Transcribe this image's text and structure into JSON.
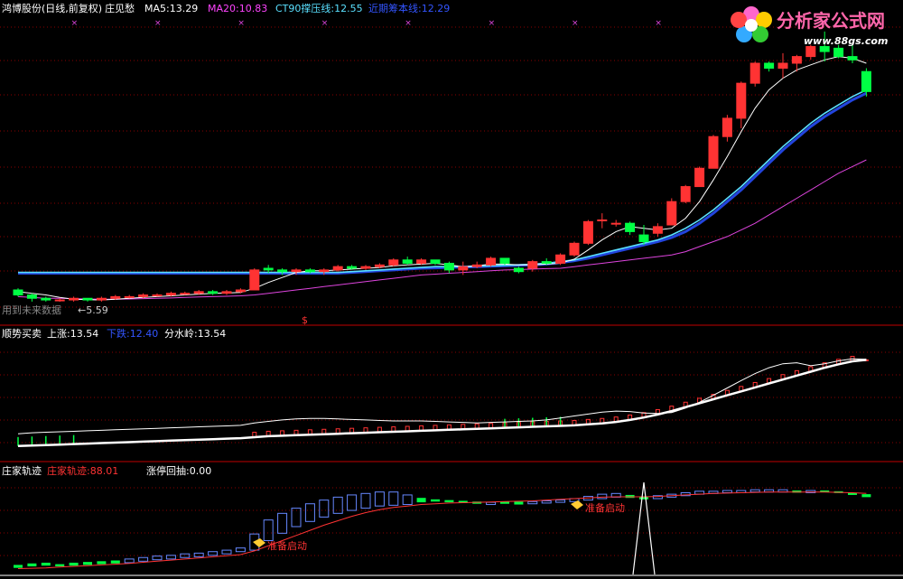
{
  "panels": {
    "main": {
      "title": "鸿博股份(日线,前复权)",
      "indicator_name": "庄见愁",
      "legend": [
        {
          "label": "MA5:",
          "value": "13.29",
          "color": "#ffffff"
        },
        {
          "label": "MA20:",
          "value": "10.83",
          "color": "#ff44ff"
        },
        {
          "label": "CT90撑压线:",
          "value": "12.55",
          "color": "#5ae0ff"
        },
        {
          "label": "近期筹本线:",
          "value": "12.29",
          "color": "#3355ff"
        }
      ],
      "note": "用到未来数据",
      "low_marker": "←5.59",
      "signal_glyph": "$"
    },
    "middle": {
      "title": "顺势买卖",
      "legend": [
        {
          "label": "上涨:",
          "value": "13.54",
          "color": "#ffffff"
        },
        {
          "label": "下跌:",
          "value": "12.40",
          "color": "#3355ff"
        },
        {
          "label": "分水岭:",
          "value": "13.54",
          "color": "#ffffff"
        }
      ]
    },
    "bottom": {
      "title": "庄家轨迹",
      "legend": [
        {
          "label": "庄家轨迹:",
          "value": "88.01",
          "color": "#ff3333"
        },
        {
          "label": "涨停回抽:",
          "value": "0.00",
          "color": "#ffffff"
        }
      ],
      "annotations": [
        "准备启动",
        "准备启动"
      ]
    }
  },
  "logo": {
    "name": "分析家公式网",
    "url": "www.88gs.com"
  },
  "colors": {
    "up": "#ff3333",
    "down": "#00ff44",
    "grid": "#8a0000",
    "divider": "#c00000"
  },
  "chart_data": {
    "type": "candlestick",
    "candles": [
      [
        6.3,
        6.4,
        5.9,
        6.0
      ],
      [
        6.0,
        6.1,
        5.6,
        5.8
      ],
      [
        5.8,
        5.9,
        5.6,
        5.7
      ],
      [
        5.7,
        5.8,
        5.59,
        5.7
      ],
      [
        5.7,
        5.9,
        5.6,
        5.8
      ],
      [
        5.8,
        5.8,
        5.6,
        5.7
      ],
      [
        5.7,
        5.9,
        5.6,
        5.8
      ],
      [
        5.8,
        6.0,
        5.7,
        5.9
      ],
      [
        5.9,
        6.0,
        5.8,
        5.9
      ],
      [
        5.9,
        6.1,
        5.8,
        6.0
      ],
      [
        6.0,
        6.1,
        5.9,
        6.0
      ],
      [
        6.0,
        6.2,
        5.9,
        6.1
      ],
      [
        6.1,
        6.2,
        6.0,
        6.1
      ],
      [
        6.1,
        6.3,
        6.0,
        6.2
      ],
      [
        6.2,
        6.3,
        6.0,
        6.1
      ],
      [
        6.1,
        6.3,
        6.0,
        6.2
      ],
      [
        6.2,
        6.4,
        6.1,
        6.3
      ],
      [
        6.3,
        7.6,
        6.3,
        7.5
      ],
      [
        7.6,
        7.8,
        7.3,
        7.5
      ],
      [
        7.5,
        7.6,
        7.2,
        7.4
      ],
      [
        7.4,
        7.6,
        7.2,
        7.5
      ],
      [
        7.5,
        7.6,
        7.3,
        7.4
      ],
      [
        7.4,
        7.6,
        7.2,
        7.5
      ],
      [
        7.5,
        7.8,
        7.4,
        7.7
      ],
      [
        7.7,
        7.8,
        7.5,
        7.6
      ],
      [
        7.6,
        7.8,
        7.5,
        7.7
      ],
      [
        7.7,
        7.9,
        7.6,
        7.8
      ],
      [
        7.8,
        8.2,
        7.7,
        8.1
      ],
      [
        8.1,
        8.3,
        7.8,
        7.9
      ],
      [
        7.9,
        8.2,
        7.8,
        8.1
      ],
      [
        8.1,
        8.1,
        7.8,
        7.9
      ],
      [
        7.9,
        8.0,
        7.3,
        7.5
      ],
      [
        7.5,
        8.0,
        7.2,
        7.7
      ],
      [
        7.7,
        8.0,
        7.6,
        7.8
      ],
      [
        7.8,
        8.3,
        7.7,
        8.2
      ],
      [
        8.2,
        8.2,
        7.8,
        7.9
      ],
      [
        7.6,
        7.7,
        7.3,
        7.4
      ],
      [
        7.6,
        8.1,
        7.4,
        8.0
      ],
      [
        8.0,
        8.2,
        7.8,
        7.9
      ],
      [
        7.9,
        8.5,
        7.8,
        8.4
      ],
      [
        8.4,
        9.2,
        8.3,
        9.1
      ],
      [
        9.1,
        10.5,
        9.0,
        10.4
      ],
      [
        10.5,
        10.9,
        10.0,
        10.5
      ],
      [
        10.3,
        10.5,
        10.1,
        10.3
      ],
      [
        10.3,
        10.4,
        9.6,
        9.8
      ],
      [
        9.6,
        10.2,
        9.0,
        9.2
      ],
      [
        9.7,
        10.3,
        9.5,
        10.1
      ],
      [
        10.2,
        11.8,
        10.2,
        11.6
      ],
      [
        11.6,
        12.6,
        11.5,
        12.5
      ],
      [
        12.5,
        13.7,
        12.5,
        13.6
      ],
      [
        13.6,
        15.6,
        13.6,
        15.5
      ],
      [
        15.5,
        16.8,
        15.2,
        16.6
      ],
      [
        16.6,
        18.8,
        16.0,
        18.7
      ],
      [
        18.7,
        20.0,
        18.5,
        19.9
      ],
      [
        19.9,
        20.0,
        19.4,
        19.6
      ],
      [
        19.6,
        20.5,
        19.0,
        19.9
      ],
      [
        19.9,
        20.4,
        19.4,
        20.3
      ],
      [
        20.3,
        21.0,
        20.1,
        20.9
      ],
      [
        20.9,
        21.8,
        20.0,
        20.6
      ],
      [
        20.8,
        21.0,
        20.2,
        20.3
      ],
      [
        20.3,
        21.0,
        19.9,
        20.1
      ],
      [
        19.4,
        19.6,
        17.9,
        18.2
      ]
    ],
    "ma5": [
      6.2,
      6.1,
      6.0,
      5.85,
      5.75,
      5.72,
      5.7,
      5.75,
      5.8,
      5.85,
      5.9,
      5.95,
      6.0,
      6.05,
      6.1,
      6.12,
      6.15,
      6.4,
      6.75,
      7.05,
      7.35,
      7.45,
      7.45,
      7.5,
      7.55,
      7.6,
      7.65,
      7.75,
      7.8,
      7.85,
      7.9,
      7.8,
      7.7,
      7.75,
      7.85,
      7.85,
      7.8,
      7.8,
      7.85,
      7.9,
      8.15,
      8.7,
      9.3,
      9.8,
      10.1,
      10.0,
      9.9,
      10.0,
      10.6,
      11.6,
      12.9,
      14.3,
      15.8,
      17.2,
      18.3,
      19.0,
      19.5,
      19.8,
      20.1,
      20.3,
      20.2,
      19.9
    ],
    "ma20": [
      5.9,
      5.85,
      5.8,
      5.8,
      5.78,
      5.76,
      5.75,
      5.75,
      5.76,
      5.78,
      5.8,
      5.82,
      5.85,
      5.88,
      5.9,
      5.92,
      5.95,
      6.0,
      6.1,
      6.2,
      6.3,
      6.4,
      6.5,
      6.6,
      6.7,
      6.8,
      6.9,
      7.0,
      7.1,
      7.2,
      7.25,
      7.3,
      7.35,
      7.4,
      7.45,
      7.5,
      7.52,
      7.55,
      7.58,
      7.6,
      7.7,
      7.8,
      7.9,
      8.0,
      8.1,
      8.2,
      8.3,
      8.4,
      8.6,
      8.9,
      9.2,
      9.5,
      9.9,
      10.3,
      10.8,
      11.3,
      11.8,
      12.3,
      12.8,
      13.3,
      13.7,
      14.1
    ],
    "ct90": [
      7.35,
      7.35,
      7.35,
      7.35,
      7.35,
      7.35,
      7.35,
      7.35,
      7.35,
      7.35,
      7.35,
      7.35,
      7.35,
      7.35,
      7.35,
      7.35,
      7.35,
      7.35,
      7.35,
      7.35,
      7.35,
      7.35,
      7.35,
      7.35,
      7.4,
      7.45,
      7.5,
      7.55,
      7.6,
      7.65,
      7.7,
      7.7,
      7.7,
      7.72,
      7.75,
      7.78,
      7.8,
      7.85,
      7.9,
      8.0,
      8.1,
      8.3,
      8.5,
      8.7,
      8.9,
      9.1,
      9.3,
      9.6,
      10.0,
      10.5,
      11.1,
      11.8,
      12.5,
      13.3,
      14.1,
      14.9,
      15.6,
      16.3,
      16.9,
      17.4,
      17.9,
      18.3
    ],
    "cost": [
      7.3,
      7.3,
      7.3,
      7.3,
      7.3,
      7.3,
      7.3,
      7.3,
      7.3,
      7.3,
      7.3,
      7.3,
      7.3,
      7.3,
      7.3,
      7.3,
      7.3,
      7.3,
      7.3,
      7.3,
      7.3,
      7.3,
      7.3,
      7.3,
      7.35,
      7.4,
      7.45,
      7.5,
      7.55,
      7.6,
      7.62,
      7.65,
      7.67,
      7.7,
      7.72,
      7.75,
      7.78,
      7.8,
      7.85,
      7.95,
      8.05,
      8.2,
      8.4,
      8.6,
      8.8,
      9.0,
      9.2,
      9.45,
      9.8,
      10.3,
      10.9,
      11.6,
      12.3,
      13.1,
      13.9,
      14.7,
      15.4,
      16.1,
      16.7,
      17.2,
      17.7,
      18.1
    ],
    "signal_bars": [
      0,
      17
    ],
    "ylim_main": [
      5.0,
      22.5
    ],
    "trend_white": [
      4.0,
      4.2,
      4.3,
      4.4,
      4.5,
      4.6,
      4.7,
      4.8,
      4.9,
      5.0,
      5.1,
      5.2,
      5.3,
      5.4,
      5.5,
      5.6,
      5.7,
      6.2,
      6.5,
      6.8,
      7.0,
      7.1,
      7.1,
      7.0,
      6.9,
      6.8,
      6.7,
      6.6,
      6.6,
      6.6,
      6.5,
      6.4,
      6.3,
      6.2,
      6.3,
      6.4,
      6.5,
      6.6,
      6.8,
      7.2,
      7.6,
      8.0,
      8.4,
      8.6,
      8.5,
      8.2,
      8.1,
      8.3,
      9.2,
      10.4,
      11.8,
      13.3,
      14.8,
      16.2,
      17.4,
      18.2,
      18.4,
      17.8,
      18.2,
      18.8,
      19.2,
      19.1
    ],
    "trend_low": [
      1.5,
      1.6,
      1.7,
      1.8,
      1.9,
      2.0,
      2.1,
      2.2,
      2.3,
      2.4,
      2.5,
      2.6,
      2.7,
      2.8,
      2.9,
      3.0,
      3.1,
      3.3,
      3.5,
      3.6,
      3.7,
      3.8,
      3.9,
      4.0,
      4.1,
      4.2,
      4.3,
      4.4,
      4.5,
      4.6,
      4.7,
      4.8,
      4.9,
      5.0,
      5.1,
      5.2,
      5.3,
      5.4,
      5.5,
      5.6,
      5.7,
      5.9,
      6.1,
      6.4,
      6.8,
      7.3,
      7.9,
      8.6,
      9.4,
      10.2,
      11.0,
      11.8,
      12.6,
      13.4,
      14.2,
      15.0,
      15.8,
      16.6,
      17.4,
      18.1,
      18.7,
      19.0
    ],
    "trend_red_top": [
      2.5,
      2.6,
      2.7,
      2.8,
      2.9,
      3.0,
      3.1,
      3.2,
      3.3,
      3.4,
      3.5,
      3.6,
      3.7,
      3.8,
      3.9,
      4.0,
      4.1,
      4.3,
      4.5,
      4.6,
      4.7,
      4.8,
      4.9,
      5.0,
      5.1,
      5.2,
      5.3,
      5.4,
      5.5,
      5.6,
      5.7,
      5.8,
      5.9,
      6.0,
      6.1,
      6.2,
      6.3,
      6.4,
      6.5,
      6.6,
      6.7,
      6.9,
      7.1,
      7.4,
      7.8,
      8.3,
      8.9,
      9.6,
      10.4,
      11.2,
      12.0,
      12.8,
      13.6,
      14.4,
      15.2,
      16.0,
      16.8,
      17.6,
      18.4,
      19.1,
      19.7,
      19.0
    ],
    "green_spikes": [
      0,
      1,
      2,
      3,
      4,
      32,
      33,
      34,
      35,
      36
    ],
    "ylim_mid": [
      0,
      22
    ],
    "track_bars": [
      [
        0.9,
        1.3,
        "down"
      ],
      [
        1.1,
        1.5,
        "down"
      ],
      [
        1.2,
        1.6,
        "down"
      ],
      [
        1.1,
        1.4,
        "down"
      ],
      [
        1.2,
        1.6,
        "down"
      ],
      [
        1.3,
        1.7,
        "down"
      ],
      [
        1.4,
        1.8,
        "down"
      ],
      [
        1.5,
        1.9,
        "down"
      ],
      [
        1.6,
        2.1,
        "up"
      ],
      [
        1.8,
        2.3,
        "up"
      ],
      [
        2.0,
        2.5,
        "up"
      ],
      [
        2.1,
        2.6,
        "up"
      ],
      [
        2.3,
        2.8,
        "up"
      ],
      [
        2.4,
        2.9,
        "up"
      ],
      [
        2.6,
        3.1,
        "up"
      ],
      [
        2.8,
        3.3,
        "up"
      ],
      [
        3.1,
        3.6,
        "up"
      ],
      [
        3.3,
        5.5,
        "up"
      ],
      [
        4.6,
        7.4,
        "up"
      ],
      [
        5.6,
        8.3,
        "up"
      ],
      [
        6.5,
        9.0,
        "up"
      ],
      [
        7.2,
        9.6,
        "up"
      ],
      [
        7.8,
        10.1,
        "up"
      ],
      [
        8.3,
        10.5,
        "up"
      ],
      [
        8.7,
        10.8,
        "up"
      ],
      [
        9.0,
        11.0,
        "up"
      ],
      [
        9.3,
        11.2,
        "up"
      ],
      [
        9.4,
        11.2,
        "up"
      ],
      [
        9.5,
        10.8,
        "up"
      ],
      [
        9.8,
        10.4,
        "down"
      ],
      [
        9.9,
        10.2,
        "down"
      ],
      [
        9.8,
        10.1,
        "down"
      ],
      [
        9.7,
        10.0,
        "down"
      ],
      [
        9.6,
        9.9,
        "down"
      ],
      [
        9.5,
        9.8,
        "up"
      ],
      [
        9.6,
        9.9,
        "down"
      ],
      [
        9.5,
        9.9,
        "down"
      ],
      [
        9.6,
        9.9,
        "up"
      ],
      [
        9.7,
        10.0,
        "up"
      ],
      [
        9.8,
        10.1,
        "up"
      ],
      [
        9.9,
        10.3,
        "up"
      ],
      [
        10.1,
        10.6,
        "up"
      ],
      [
        10.3,
        10.9,
        "up"
      ],
      [
        10.5,
        11.0,
        "up"
      ],
      [
        10.4,
        10.8,
        "down"
      ],
      [
        10.2,
        10.6,
        "down"
      ],
      [
        10.3,
        10.7,
        "up"
      ],
      [
        10.5,
        10.9,
        "up"
      ],
      [
        10.7,
        11.1,
        "up"
      ],
      [
        10.9,
        11.3,
        "up"
      ],
      [
        11.0,
        11.3,
        "up"
      ],
      [
        11.1,
        11.4,
        "up"
      ],
      [
        11.1,
        11.4,
        "up"
      ],
      [
        11.2,
        11.5,
        "up"
      ],
      [
        11.2,
        11.5,
        "up"
      ],
      [
        11.2,
        11.5,
        "up"
      ],
      [
        11.1,
        11.4,
        "down"
      ],
      [
        11.1,
        11.4,
        "up"
      ],
      [
        11.2,
        11.4,
        "down"
      ],
      [
        11.1,
        11.3,
        "down"
      ],
      [
        10.8,
        11.1,
        "down"
      ],
      [
        10.5,
        10.9,
        "down"
      ]
    ],
    "track_line": [
      0.8,
      0.85,
      0.9,
      1.0,
      1.1,
      1.2,
      1.3,
      1.4,
      1.5,
      1.65,
      1.8,
      1.95,
      2.1,
      2.25,
      2.4,
      2.55,
      2.7,
      3.2,
      3.9,
      4.6,
      5.3,
      6.0,
      6.7,
      7.3,
      7.9,
      8.4,
      8.8,
      9.1,
      9.3,
      9.5,
      9.6,
      9.7,
      9.75,
      9.8,
      9.85,
      9.9,
      9.95,
      10.0,
      10.1,
      10.2,
      10.3,
      10.4,
      10.5,
      10.55,
      10.55,
      10.55,
      10.6,
      10.7,
      10.8,
      10.9,
      11.0,
      11.05,
      11.1,
      11.15,
      11.2,
      11.2,
      11.2,
      11.2,
      11.2,
      11.15,
      11.1,
      11.0
    ],
    "spike": {
      "index": 45,
      "value": 12.5
    },
    "ylim_bot": [
      0,
      13
    ]
  }
}
